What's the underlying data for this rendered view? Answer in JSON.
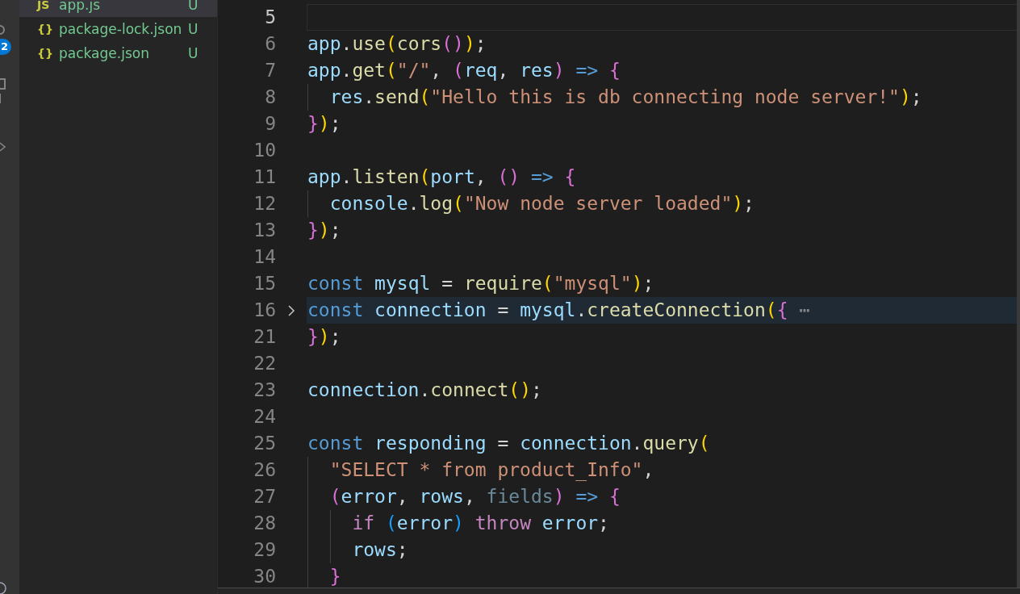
{
  "activity_bar": {
    "badge": "2"
  },
  "explorer": {
    "items": [
      {
        "icon": "JS",
        "name": "app.js",
        "status": "U",
        "selected": true
      },
      {
        "icon": "{}",
        "name": "package-lock.json",
        "status": "U",
        "selected": false
      },
      {
        "icon": "{}",
        "name": "package.json",
        "status": "U",
        "selected": false
      }
    ]
  },
  "editor": {
    "lines": [
      {
        "number": "5",
        "cursor": true,
        "highlighted": false,
        "folded": false
      },
      {
        "number": "6",
        "cursor": false,
        "highlighted": false,
        "folded": false,
        "tokens": [
          {
            "text": "app",
            "kind": "var"
          },
          {
            "text": ".",
            "kind": "p"
          },
          {
            "text": "use",
            "kind": "fn"
          },
          {
            "text": "(",
            "kind": "b1"
          },
          {
            "text": "cors",
            "kind": "fn"
          },
          {
            "text": "()",
            "kind": "b2"
          },
          {
            "text": ")",
            "kind": "b1"
          },
          {
            "text": ";",
            "kind": "p"
          }
        ]
      },
      {
        "number": "7",
        "cursor": false,
        "highlighted": false,
        "folded": false,
        "tokens": [
          {
            "text": "app",
            "kind": "var"
          },
          {
            "text": ".",
            "kind": "p"
          },
          {
            "text": "get",
            "kind": "fn"
          },
          {
            "text": "(",
            "kind": "b1"
          },
          {
            "text": "\"/\"",
            "kind": "str"
          },
          {
            "text": ", ",
            "kind": "p"
          },
          {
            "text": "(",
            "kind": "b2"
          },
          {
            "text": "req",
            "kind": "var"
          },
          {
            "text": ", ",
            "kind": "p"
          },
          {
            "text": "res",
            "kind": "var"
          },
          {
            "text": ")",
            "kind": "b2"
          },
          {
            "text": " => ",
            "kind": "kw"
          },
          {
            "text": "{",
            "kind": "b2"
          }
        ]
      },
      {
        "number": "8",
        "cursor": false,
        "highlighted": false,
        "folded": false,
        "tokens": [
          {
            "text": "  res",
            "kind": "var"
          },
          {
            "text": ".",
            "kind": "p"
          },
          {
            "text": "send",
            "kind": "fn"
          },
          {
            "text": "(",
            "kind": "b1"
          },
          {
            "text": "\"Hello this is db connecting node server!\"",
            "kind": "str"
          },
          {
            "text": ")",
            "kind": "b1"
          },
          {
            "text": ";",
            "kind": "p"
          }
        ]
      },
      {
        "number": "9",
        "cursor": false,
        "highlighted": false,
        "folded": false,
        "tokens": [
          {
            "text": "}",
            "kind": "b2"
          },
          {
            "text": ")",
            "kind": "b1"
          },
          {
            "text": ";",
            "kind": "p"
          }
        ]
      },
      {
        "number": "10",
        "cursor": false,
        "highlighted": false,
        "folded": false
      },
      {
        "number": "11",
        "cursor": false,
        "highlighted": false,
        "folded": false,
        "tokens": [
          {
            "text": "app",
            "kind": "var"
          },
          {
            "text": ".",
            "kind": "p"
          },
          {
            "text": "listen",
            "kind": "fn"
          },
          {
            "text": "(",
            "kind": "b1"
          },
          {
            "text": "port",
            "kind": "var"
          },
          {
            "text": ", ",
            "kind": "p"
          },
          {
            "text": "()",
            "kind": "b2"
          },
          {
            "text": " => ",
            "kind": "kw"
          },
          {
            "text": "{",
            "kind": "b2"
          }
        ]
      },
      {
        "number": "12",
        "cursor": false,
        "highlighted": false,
        "folded": false,
        "tokens": [
          {
            "text": "  console",
            "kind": "var"
          },
          {
            "text": ".",
            "kind": "p"
          },
          {
            "text": "log",
            "kind": "fn"
          },
          {
            "text": "(",
            "kind": "b1"
          },
          {
            "text": "\"Now node server loaded\"",
            "kind": "str"
          },
          {
            "text": ")",
            "kind": "b1"
          },
          {
            "text": ";",
            "kind": "p"
          }
        ]
      },
      {
        "number": "13",
        "cursor": false,
        "highlighted": false,
        "folded": false,
        "tokens": [
          {
            "text": "}",
            "kind": "b2"
          },
          {
            "text": ")",
            "kind": "b1"
          },
          {
            "text": ";",
            "kind": "p"
          }
        ]
      },
      {
        "number": "14",
        "cursor": false,
        "highlighted": false,
        "folded": false
      },
      {
        "number": "15",
        "cursor": false,
        "highlighted": false,
        "folded": false,
        "tokens": [
          {
            "text": "const",
            "kind": "kw"
          },
          {
            "text": " mysql",
            "kind": "var"
          },
          {
            "text": " = ",
            "kind": "p"
          },
          {
            "text": "require",
            "kind": "fn"
          },
          {
            "text": "(",
            "kind": "b1"
          },
          {
            "text": "\"mysql\"",
            "kind": "str"
          },
          {
            "text": ")",
            "kind": "b1"
          },
          {
            "text": ";",
            "kind": "p"
          }
        ]
      },
      {
        "number": "16",
        "cursor": false,
        "highlighted": true,
        "folded": true,
        "tokens": [
          {
            "text": "const",
            "kind": "kw"
          },
          {
            "text": " connection",
            "kind": "var"
          },
          {
            "text": " = ",
            "kind": "p"
          },
          {
            "text": "mysql",
            "kind": "var"
          },
          {
            "text": ".",
            "kind": "p"
          },
          {
            "text": "createConnection",
            "kind": "fn"
          },
          {
            "text": "(",
            "kind": "b1"
          },
          {
            "text": "{",
            "kind": "b2"
          },
          {
            "text": " ⋯",
            "kind": "fold"
          }
        ]
      },
      {
        "number": "21",
        "cursor": false,
        "highlighted": false,
        "folded": false,
        "tokens": [
          {
            "text": "}",
            "kind": "b2"
          },
          {
            "text": ")",
            "kind": "b1"
          },
          {
            "text": ";",
            "kind": "p"
          }
        ]
      },
      {
        "number": "22",
        "cursor": false,
        "highlighted": false,
        "folded": false
      },
      {
        "number": "23",
        "cursor": false,
        "highlighted": false,
        "folded": false,
        "tokens": [
          {
            "text": "connection",
            "kind": "var"
          },
          {
            "text": ".",
            "kind": "p"
          },
          {
            "text": "connect",
            "kind": "fn"
          },
          {
            "text": "(",
            "kind": "b1"
          },
          {
            "text": ")",
            "kind": "b1"
          },
          {
            "text": ";",
            "kind": "p"
          }
        ]
      },
      {
        "number": "24",
        "cursor": false,
        "highlighted": false,
        "folded": false
      },
      {
        "number": "25",
        "cursor": false,
        "highlighted": false,
        "folded": false,
        "tokens": [
          {
            "text": "const",
            "kind": "kw"
          },
          {
            "text": " responding",
            "kind": "var"
          },
          {
            "text": " = ",
            "kind": "p"
          },
          {
            "text": "connection",
            "kind": "var"
          },
          {
            "text": ".",
            "kind": "p"
          },
          {
            "text": "query",
            "kind": "fn"
          },
          {
            "text": "(",
            "kind": "b1"
          }
        ]
      },
      {
        "number": "26",
        "cursor": false,
        "highlighted": false,
        "folded": false,
        "tokens": [
          {
            "text": "  \"SELECT * from product_Info\"",
            "kind": "str"
          },
          {
            "text": ",",
            "kind": "p"
          }
        ]
      },
      {
        "number": "27",
        "cursor": false,
        "highlighted": false,
        "folded": false,
        "tokens": [
          {
            "text": "  (",
            "kind": "b2"
          },
          {
            "text": "error",
            "kind": "var"
          },
          {
            "text": ", ",
            "kind": "p"
          },
          {
            "text": "rows",
            "kind": "var"
          },
          {
            "text": ", ",
            "kind": "p"
          },
          {
            "text": "fields",
            "kind": "dim"
          },
          {
            "text": ")",
            "kind": "b2"
          },
          {
            "text": " => ",
            "kind": "kw"
          },
          {
            "text": "{",
            "kind": "b2"
          }
        ]
      },
      {
        "number": "28",
        "cursor": false,
        "highlighted": false,
        "folded": false,
        "tokens": [
          {
            "text": "    if ",
            "kind": "ctrl"
          },
          {
            "text": "(",
            "kind": "b3"
          },
          {
            "text": "error",
            "kind": "var"
          },
          {
            "text": ")",
            "kind": "b3"
          },
          {
            "text": " throw",
            "kind": "ctrl"
          },
          {
            "text": " error",
            "kind": "var"
          },
          {
            "text": ";",
            "kind": "p"
          }
        ]
      },
      {
        "number": "29",
        "cursor": false,
        "highlighted": false,
        "folded": false,
        "tokens": [
          {
            "text": "    rows",
            "kind": "var"
          },
          {
            "text": ";",
            "kind": "p"
          }
        ]
      },
      {
        "number": "30",
        "cursor": false,
        "highlighted": false,
        "folded": false,
        "tokens": [
          {
            "text": "  }",
            "kind": "b2"
          }
        ]
      }
    ]
  }
}
